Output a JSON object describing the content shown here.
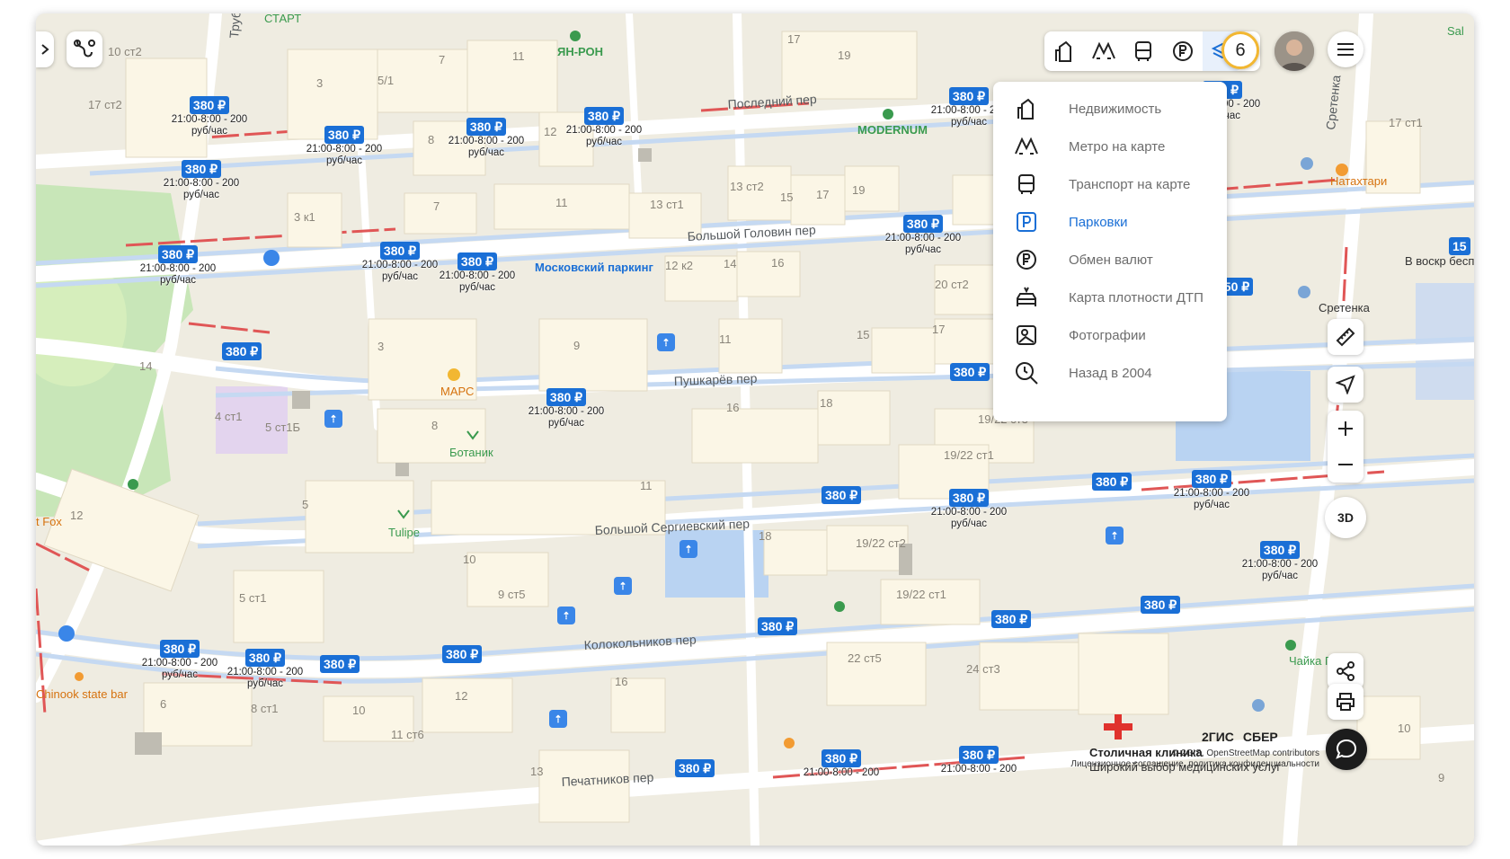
{
  "map": {
    "roads": [
      {
        "id": "posledniy",
        "label": "Последний пер"
      },
      {
        "id": "bolshoy-golovin",
        "label": "Большой Головин пер"
      },
      {
        "id": "pushkarev",
        "label": "Пушкарёв пер"
      },
      {
        "id": "bolshoy-sergievsky",
        "label": "Большой Сергиевский пер"
      },
      {
        "id": "kolokolnikov",
        "label": "Колокольников пер"
      },
      {
        "id": "pechatnikov",
        "label": "Печатников пер"
      },
      {
        "id": "sretenka",
        "label": "Сретенка"
      },
      {
        "id": "trub",
        "label": "Труб"
      }
    ],
    "places": [
      {
        "id": "start",
        "label": "СТАРТ",
        "color": "#3a9a4e"
      },
      {
        "id": "yan-ron",
        "label": "ЯН-РОН",
        "color": "#3a9a4e"
      },
      {
        "id": "modernum",
        "label": "MODERNUM",
        "color": "#3a9a4e"
      },
      {
        "id": "moskovsky-parking",
        "label": "Московский паркинг",
        "color": "#1a6fd6"
      },
      {
        "id": "mars",
        "label": "МАРС",
        "color": "#d6720e"
      },
      {
        "id": "botanik",
        "label": "Ботаник",
        "color": "#3a9a4e"
      },
      {
        "id": "tulipe",
        "label": "Tulipe",
        "color": "#3a9a4e"
      },
      {
        "id": "t-fox",
        "label": "t Fox",
        "color": "#d6720e"
      },
      {
        "id": "chinook",
        "label": "Chinook state bar",
        "color": "#d6720e"
      },
      {
        "id": "natahtari",
        "label": "Натахтари",
        "color": "#d6720e"
      },
      {
        "id": "sretenka-metro",
        "label": "Сретенка",
        "color": "#333333"
      },
      {
        "id": "chayka",
        "label": "Чайка Плаза",
        "color": "#3a9a4e"
      },
      {
        "id": "stolichnaya",
        "label": "Столичная клиника",
        "color": "#222222"
      },
      {
        "id": "stolichnaya-sub",
        "label": "Широкий выбор медицинских услуг",
        "color": "#333333"
      },
      {
        "id": "v-voskr",
        "label": "В воскр бесп",
        "color": "#333333"
      },
      {
        "id": "sal",
        "label": "Sal",
        "color": "#3a9a4e"
      }
    ],
    "building_numbers": [
      "10 ст2",
      "17 ст2",
      "3",
      "5/1",
      "7",
      "11",
      "17",
      "19",
      "8",
      "12",
      "3 к1",
      "7",
      "11",
      "13 ст2",
      "15",
      "17",
      "19",
      "13 ст1",
      "12 к2",
      "14",
      "16",
      "20 ст2",
      "3",
      "9",
      "11",
      "15",
      "17",
      "14",
      "4 ст1",
      "5 ст1Б",
      "8",
      "16",
      "18",
      "19/22 ст3",
      "19/22 ст1",
      "5",
      "11",
      "12",
      "10",
      "9 ст5",
      "18",
      "19/22 ст2",
      "19/22 ст1",
      "5 ст1",
      "22 ст5",
      "24 ст3",
      "6",
      "8 ст1",
      "10",
      "12",
      "16",
      "11 ст6",
      "13",
      "17 ст1",
      "10",
      "9"
    ]
  },
  "parking": {
    "price_label": "380 ₽",
    "price_label_alt": "150 ₽",
    "schedule_line1": "21:00-8:00 - 200",
    "schedule_line2": "руб/час",
    "badge_15": "15"
  },
  "toolbar": {
    "items": [
      {
        "name": "real-estate",
        "icon": "building-icon"
      },
      {
        "name": "metro",
        "icon": "metro-icon"
      },
      {
        "name": "transport",
        "icon": "bus-icon"
      },
      {
        "name": "currency",
        "icon": "ruble-icon"
      },
      {
        "name": "layers",
        "icon": "layers-icon",
        "active": true
      }
    ],
    "notifications_count": "6"
  },
  "layers_menu": {
    "items": [
      {
        "label": "Недвижимость",
        "icon": "building-icon"
      },
      {
        "label": "Метро на карте",
        "icon": "metro-icon"
      },
      {
        "label": "Транспорт на карте",
        "icon": "bus-icon"
      },
      {
        "label": "Парковки",
        "icon": "parking-icon",
        "active": true
      },
      {
        "label": "Обмен валют",
        "icon": "ruble-icon"
      },
      {
        "label": "Карта плотности ДТП",
        "icon": "car-crash-icon"
      },
      {
        "label": "Фотографии",
        "icon": "photo-icon"
      },
      {
        "label": "Назад в 2004",
        "icon": "time-back-icon"
      }
    ]
  },
  "controls": {
    "view_3d": "3D"
  },
  "brand": {
    "dgis": "2ГИС",
    "sber": "СБЕР",
    "copyright": "© 2GIS, OpenStreetMap contributors",
    "legal": "Лицензионное соглашение, политика конфиденциальности"
  },
  "colors": {
    "accent": "#1a6fd6",
    "parking_badge": "#1a6fd6",
    "map_bg": "#efece1",
    "building": "#fbf6e6",
    "road_parking": "#c5d9f2",
    "paid_line": "#e05656",
    "park": "#c8e6b8",
    "water": "#b9d3f2",
    "notification_ring": "#f2b732"
  }
}
